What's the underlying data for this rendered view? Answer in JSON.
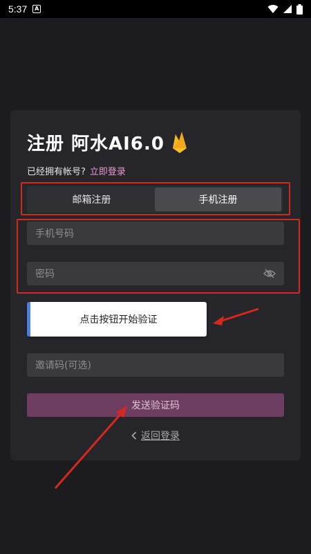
{
  "status_bar": {
    "time": "5:37",
    "notification_glyph": "A"
  },
  "card": {
    "title": "注册 阿水AI6.0",
    "has_account_hint": "已经拥有帐号?",
    "login_link": "立即登录",
    "tabs": [
      {
        "label": "邮箱注册",
        "active": false
      },
      {
        "label": "手机注册",
        "active": true
      }
    ],
    "phone_placeholder": "手机号码",
    "password_placeholder": "密码",
    "verify_button": "点击按钮开始验证",
    "invite_placeholder": "邀请码(可选)",
    "send_code_button": "发送验证码",
    "back_login": "返回登录"
  },
  "colors": {
    "background": "#1c1c1f",
    "card": "#26262a",
    "accent_link": "#e79ad0",
    "send_button": "#6e3e60",
    "annotation_red": "#d8281e",
    "verify_accent": "#4a7fe0"
  },
  "icons": [
    "wifi-icon",
    "signal-icon",
    "battery-icon",
    "flame-icon",
    "eye-off-icon",
    "chevron-left-icon"
  ]
}
